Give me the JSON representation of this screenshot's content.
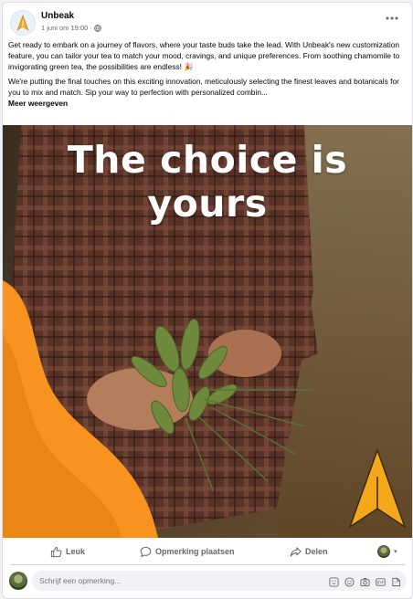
{
  "post": {
    "page_name": "Unbeak",
    "date": "1 juni om 19:00",
    "paragraph_1": "Get ready to embark on a journey of flavors, where your taste buds take the lead. With Unbeak's new customization feature, you can tailor your tea to match your mood, cravings, and unique preferences. From soothing chamomile to invigorating green tea, the possibilities are endless!",
    "paragraph_2": "We're putting the final touches on this exciting innovation, meticulously selecting the finest leaves and botanicals for you to mix and match. Sip your way to perfection with personalized combin...",
    "see_more": "Meer weergeven",
    "image_headline": "The choice is yours"
  },
  "actions": {
    "like": "Leuk",
    "comment": "Opmerking plaatsen",
    "share": "Delen"
  },
  "comment_box": {
    "placeholder": "Schrijf een opmerking..."
  },
  "colors": {
    "brand_orange": "#f7931e",
    "brand_yellow": "#f5a91a",
    "text_secondary": "#65676b"
  },
  "icons": [
    "logo-icon",
    "globe-icon",
    "more-dots-icon",
    "like-icon",
    "comment-icon",
    "share-icon",
    "avatar-dropdown-icon",
    "avatar-icon",
    "sticker-icon",
    "emoji-icon",
    "camera-icon",
    "gif-icon",
    "smiley-icon"
  ]
}
